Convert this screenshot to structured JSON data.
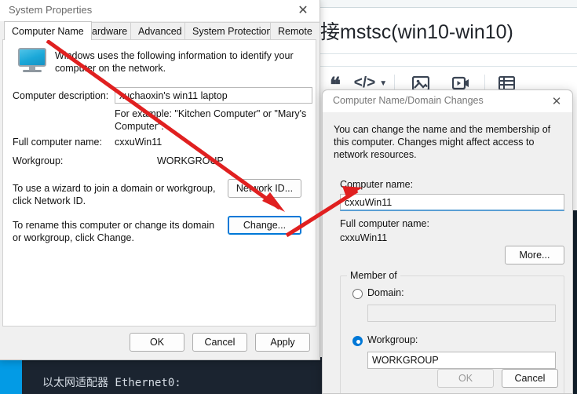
{
  "background_editor": {
    "title": "接mstsc(win10-win10)",
    "toolbar": [
      {
        "name": "quote-icon",
        "glyph": "❝"
      },
      {
        "name": "code-icon",
        "glyph": "</>"
      },
      {
        "name": "image-icon",
        "glyph": "image"
      },
      {
        "name": "video-icon",
        "glyph": "video"
      },
      {
        "name": "table-icon",
        "glyph": "table"
      }
    ]
  },
  "terminal": {
    "line": "以太网适配器 Ethernet0:"
  },
  "system_properties": {
    "title": "System Properties",
    "close_glyph": "✕",
    "tabs": [
      {
        "label": "Computer Name",
        "active": true
      },
      {
        "label": "Hardware",
        "active": false
      },
      {
        "label": "Advanced",
        "active": false
      },
      {
        "label": "System Protection",
        "active": false
      },
      {
        "label": "Remote",
        "active": false
      }
    ],
    "intro": "Windows uses the following information to identify your computer on the network.",
    "description_label": "Computer description:",
    "description_value": "xuchaoxin's win11 laptop",
    "description_hint": "For example: \"Kitchen Computer\" or \"Mary's Computer\".",
    "full_name_label": "Full computer name:",
    "full_name_value": "cxxuWin11",
    "workgroup_label": "Workgroup:",
    "workgroup_value": "WORKGROUP",
    "network_id_text": "To use a wizard to join a domain or workgroup, click Network ID.",
    "network_id_button": "Network ID...",
    "change_text": "To rename this computer or change its domain or workgroup, click Change.",
    "change_button": "Change...",
    "ok_button": "OK",
    "cancel_button": "Cancel",
    "apply_button": "Apply"
  },
  "computer_name_dialog": {
    "title": "Computer Name/Domain Changes",
    "close_glyph": "✕",
    "description": "You can change the name and the membership of this computer. Changes might affect access to network resources.",
    "computer_name_label": "Computer name:",
    "computer_name_value": "cxxuWin11",
    "full_computer_name_label": "Full computer name:",
    "full_computer_name_value": "cxxuWin11",
    "more_button": "More...",
    "member_of_label": "Member of",
    "domain_label": "Domain:",
    "domain_value": "",
    "domain_selected": false,
    "workgroup_label": "Workgroup:",
    "workgroup_value": "WORKGROUP",
    "workgroup_selected": true,
    "ok_button": "OK",
    "cancel_button": "Cancel"
  },
  "annotations": {
    "accent_color": "#e02020",
    "arrow_1_desc": "arrow from Computer Name tab to Change button",
    "arrow_2_desc": "arrow from Change button to Computer name field"
  }
}
